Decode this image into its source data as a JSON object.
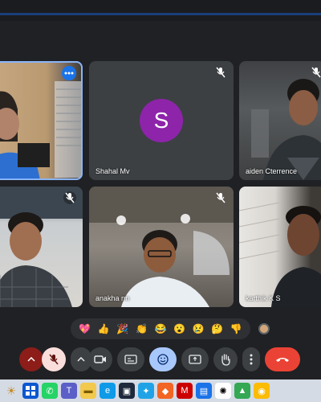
{
  "participants": [
    {
      "id": "p1",
      "name": "",
      "muted": false,
      "active": true
    },
    {
      "id": "p2",
      "name": "Shahal Mv",
      "muted": true,
      "avatar_letter": "S",
      "avatar_color": "#8e24aa"
    },
    {
      "id": "p3",
      "name": "aiden Cterrence",
      "muted": true
    },
    {
      "id": "p4",
      "name": "",
      "muted": true
    },
    {
      "id": "p5",
      "name": "anakha rm",
      "muted": true
    },
    {
      "id": "p6",
      "name": "karthik K S",
      "muted": false
    }
  ],
  "reactions": [
    "💖",
    "👍",
    "🎉",
    "👏",
    "😂",
    "😮",
    "😢",
    "🤔",
    "👎"
  ],
  "skin_tone_color": "#9aa0a6",
  "colors": {
    "accent_blue": "#8ab4f8",
    "leave_red": "#ea4335",
    "reaction_active": "#a8c7fa"
  }
}
